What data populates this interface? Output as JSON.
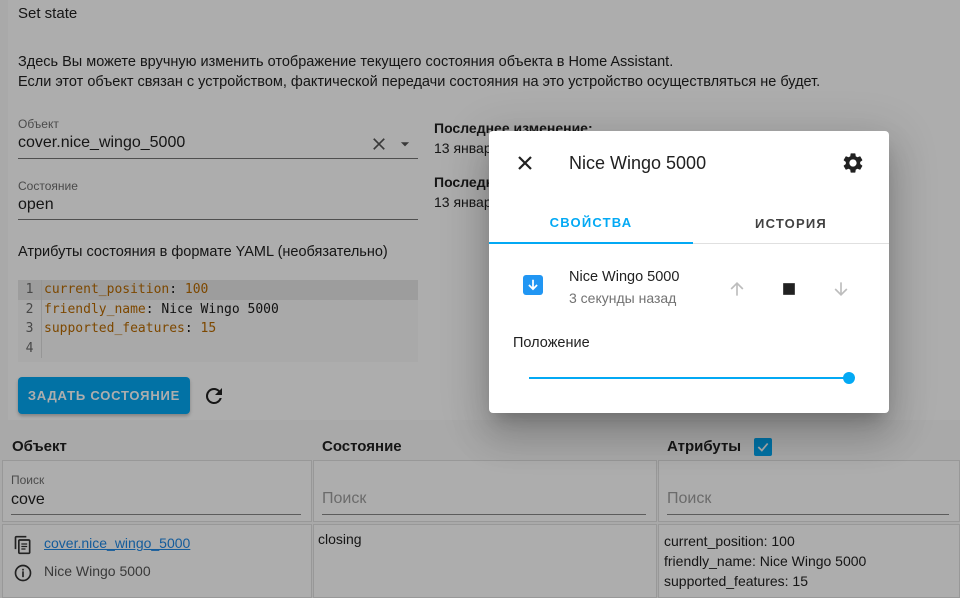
{
  "card": {
    "title": "Set state",
    "desc_line1": "Здесь Вы можете вручную изменить отображение текущего состояния объекта в Home Assistant.",
    "desc_line2": "Если этот объект связан с устройством, фактической передачи состояния на это устройство осуществляться не будет."
  },
  "form": {
    "object_label": "Объект",
    "object_value": "cover.nice_wingo_5000",
    "state_label": "Состояние",
    "state_value": "open",
    "last_changed_label": "Последнее изменение:",
    "last_changed_value": "13 январ",
    "last_updated_label": "Последн",
    "last_updated_value": "13 январ",
    "yaml_label": "Атрибуты состояния в формате YAML (необязательно)",
    "set_button": "ЗАДАТЬ СОСТОЯНИЕ"
  },
  "code": {
    "lines": [
      {
        "num": "1",
        "key": "current_position",
        "sep": ": ",
        "val": "100",
        "valtype": "n"
      },
      {
        "num": "2",
        "key": "friendly_name",
        "sep": ": ",
        "val": "Nice Wingo 5000",
        "valtype": "v"
      },
      {
        "num": "3",
        "key": "supported_features",
        "sep": ": ",
        "val": "15",
        "valtype": "n"
      },
      {
        "num": "4",
        "key": "",
        "sep": "",
        "val": "",
        "valtype": "v"
      }
    ]
  },
  "table": {
    "headers": {
      "object": "Объект",
      "state": "Состояние",
      "attributes": "Атрибуты"
    },
    "filter": {
      "search_label": "Поиск",
      "object_value": "cove",
      "state_placeholder": "Поиск",
      "attr_placeholder": "Поиск"
    },
    "row": {
      "entity_id": "cover.nice_wingo_5000",
      "friendly_name": "Nice Wingo 5000",
      "state": "closing",
      "attr1": "current_position: 100",
      "attr2": "friendly_name: Nice Wingo 5000",
      "attr3": "supported_features: 15"
    }
  },
  "dialog": {
    "title": "Nice Wingo 5000",
    "tabs": [
      {
        "label": "СВОЙСТВА"
      },
      {
        "label": "ИСТОРИЯ"
      }
    ],
    "entity_name": "Nice Wingo 5000",
    "entity_time": "3 секунды назад",
    "position_label": "Положение",
    "position_value": 100
  },
  "colors": {
    "accent": "#03a9f4",
    "icon_blue": "#2196f3"
  }
}
